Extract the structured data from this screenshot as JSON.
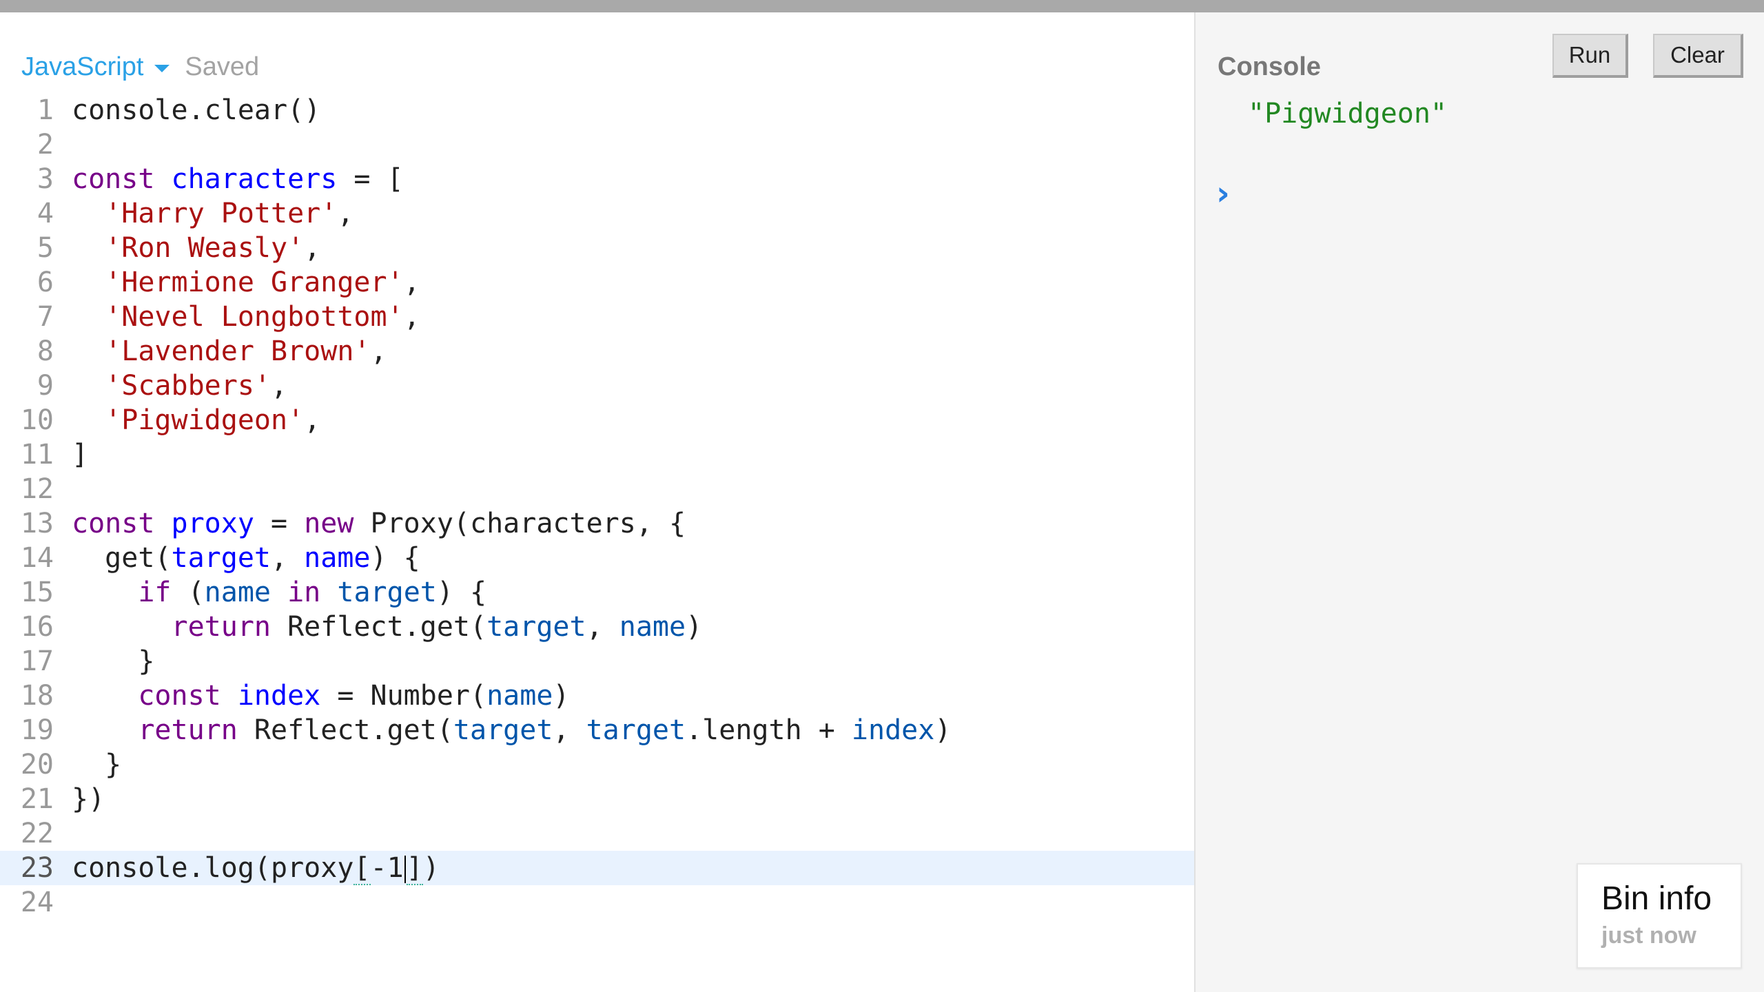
{
  "header": {
    "language": "JavaScript",
    "status": "Saved"
  },
  "editor": {
    "active_line": 23,
    "lines": [
      {
        "n": "1",
        "tokens": [
          [
            "plain",
            "console.clear()"
          ]
        ]
      },
      {
        "n": "2",
        "tokens": []
      },
      {
        "n": "3",
        "tokens": [
          [
            "kw",
            "const"
          ],
          [
            "plain",
            " "
          ],
          [
            "def",
            "characters"
          ],
          [
            "plain",
            " = ["
          ]
        ]
      },
      {
        "n": "4",
        "tokens": [
          [
            "plain",
            "  "
          ],
          [
            "str",
            "'Harry Potter'"
          ],
          [
            "plain",
            ","
          ]
        ]
      },
      {
        "n": "5",
        "tokens": [
          [
            "plain",
            "  "
          ],
          [
            "str",
            "'Ron Weasly'"
          ],
          [
            "plain",
            ","
          ]
        ]
      },
      {
        "n": "6",
        "tokens": [
          [
            "plain",
            "  "
          ],
          [
            "str",
            "'Hermione Granger'"
          ],
          [
            "plain",
            ","
          ]
        ]
      },
      {
        "n": "7",
        "tokens": [
          [
            "plain",
            "  "
          ],
          [
            "str",
            "'Nevel Longbottom'"
          ],
          [
            "plain",
            ","
          ]
        ]
      },
      {
        "n": "8",
        "tokens": [
          [
            "plain",
            "  "
          ],
          [
            "str",
            "'Lavender Brown'"
          ],
          [
            "plain",
            ","
          ]
        ]
      },
      {
        "n": "9",
        "tokens": [
          [
            "plain",
            "  "
          ],
          [
            "str",
            "'Scabbers'"
          ],
          [
            "plain",
            ","
          ]
        ]
      },
      {
        "n": "10",
        "tokens": [
          [
            "plain",
            "  "
          ],
          [
            "str",
            "'Pigwidgeon'"
          ],
          [
            "plain",
            ","
          ]
        ]
      },
      {
        "n": "11",
        "tokens": [
          [
            "plain",
            "]"
          ]
        ]
      },
      {
        "n": "12",
        "tokens": []
      },
      {
        "n": "13",
        "tokens": [
          [
            "kw",
            "const"
          ],
          [
            "plain",
            " "
          ],
          [
            "def",
            "proxy"
          ],
          [
            "plain",
            " = "
          ],
          [
            "kw",
            "new"
          ],
          [
            "plain",
            " Proxy(characters, {"
          ]
        ]
      },
      {
        "n": "14",
        "tokens": [
          [
            "plain",
            "  get("
          ],
          [
            "def",
            "target"
          ],
          [
            "plain",
            ", "
          ],
          [
            "def",
            "name"
          ],
          [
            "plain",
            ") {"
          ]
        ]
      },
      {
        "n": "15",
        "tokens": [
          [
            "plain",
            "    "
          ],
          [
            "kw",
            "if"
          ],
          [
            "plain",
            " ("
          ],
          [
            "var2",
            "name"
          ],
          [
            "plain",
            " "
          ],
          [
            "kw",
            "in"
          ],
          [
            "plain",
            " "
          ],
          [
            "var2",
            "target"
          ],
          [
            "plain",
            ") {"
          ]
        ]
      },
      {
        "n": "16",
        "tokens": [
          [
            "plain",
            "      "
          ],
          [
            "kw",
            "return"
          ],
          [
            "plain",
            " Reflect.get("
          ],
          [
            "var2",
            "target"
          ],
          [
            "plain",
            ", "
          ],
          [
            "var2",
            "name"
          ],
          [
            "plain",
            ")"
          ]
        ]
      },
      {
        "n": "17",
        "tokens": [
          [
            "plain",
            "    }"
          ]
        ]
      },
      {
        "n": "18",
        "tokens": [
          [
            "plain",
            "    "
          ],
          [
            "kw",
            "const"
          ],
          [
            "plain",
            " "
          ],
          [
            "def",
            "index"
          ],
          [
            "plain",
            " = Number("
          ],
          [
            "var2",
            "name"
          ],
          [
            "plain",
            ")"
          ]
        ]
      },
      {
        "n": "19",
        "tokens": [
          [
            "plain",
            "    "
          ],
          [
            "kw",
            "return"
          ],
          [
            "plain",
            " Reflect.get("
          ],
          [
            "var2",
            "target"
          ],
          [
            "plain",
            ", "
          ],
          [
            "var2",
            "target"
          ],
          [
            "plain",
            ".length + "
          ],
          [
            "var2",
            "index"
          ],
          [
            "plain",
            ")"
          ]
        ]
      },
      {
        "n": "20",
        "tokens": [
          [
            "plain",
            "  }"
          ]
        ]
      },
      {
        "n": "21",
        "tokens": [
          [
            "plain",
            "})"
          ]
        ]
      },
      {
        "n": "22",
        "tokens": []
      },
      {
        "n": "23",
        "tokens": [
          [
            "plain",
            "console.log(proxy"
          ],
          [
            "bracket",
            "["
          ],
          [
            "plain",
            "-1"
          ],
          [
            "cursor",
            ""
          ],
          [
            "bracket",
            "]"
          ],
          [
            "plain",
            ")"
          ]
        ]
      },
      {
        "n": "24",
        "tokens": []
      }
    ]
  },
  "console": {
    "title": "Console",
    "run_label": "Run",
    "clear_label": "Clear",
    "output": "\"Pigwidgeon\"",
    "prompt_icon": "chevron-right-icon",
    "prompt_glyph": "›"
  },
  "bin_info": {
    "title": "Bin info",
    "time": "just now"
  },
  "colors": {
    "keyword": "#770088",
    "definition": "#0000ff",
    "variable": "#0055aa",
    "string": "#aa1111",
    "console_output": "#228822",
    "accent": "#2aa1e6",
    "active_line": "#e8f2fe"
  }
}
